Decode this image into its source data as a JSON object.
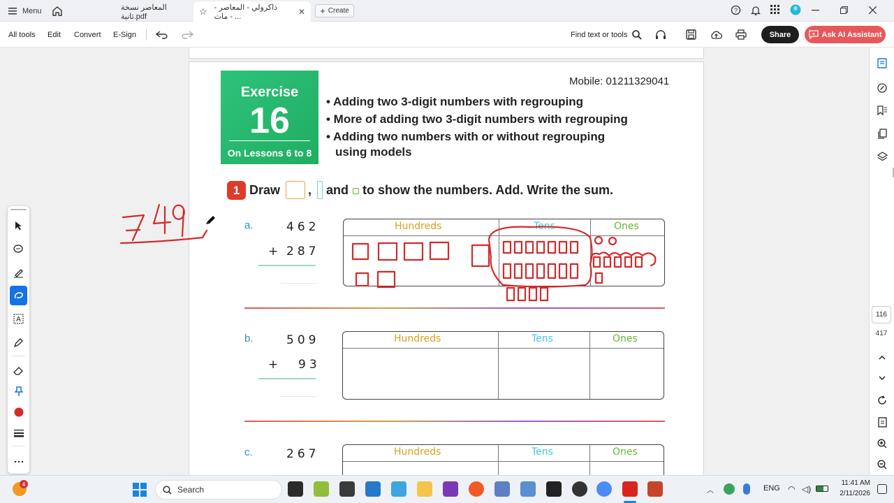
{
  "titlebar": {
    "menu_label": "Menu",
    "tabs": [
      {
        "label": "المعاصر نسخة ثانية.pdf"
      },
      {
        "label": "ذاكرولي - المعاصر - ماث - ..."
      }
    ],
    "create_label": "Create"
  },
  "toolbar": {
    "all_tools": "All tools",
    "edit": "Edit",
    "convert": "Convert",
    "esign": "E-Sign",
    "find": "Find text or tools",
    "share": "Share",
    "ask_ai": "Ask AI Assistant"
  },
  "worksheet": {
    "exercise_word": "Exercise",
    "exercise_number": "16",
    "lessons": "On Lessons 6 to 8",
    "mobile": "Mobile: 01211329041",
    "bullets": [
      "• Adding two 3-digit numbers with regrouping",
      "• More of adding two 3-digit numbers with regrouping",
      "• Adding two numbers with or without regrouping",
      "using models"
    ],
    "question_number": "1",
    "instruction_draw": "Draw",
    "instruction_comma": ",",
    "instruction_and": "and",
    "instruction_rest": "to show the numbers. Add. Write the sum.",
    "columns": [
      "Hundreds",
      "Tens",
      "Ones"
    ],
    "column_colors": {
      "hundreds": "#d9a21b",
      "tens": "#48c4d6",
      "ones": "#63b832"
    },
    "problems": [
      {
        "letter": "a.",
        "top": "462",
        "bottom": "287",
        "plus": "+"
      },
      {
        "letter": "b.",
        "top": "509",
        "bottom": "93",
        "plus": "+"
      },
      {
        "letter": "c.",
        "top": "267"
      }
    ],
    "handwritten_sum": "749"
  },
  "rail": {
    "page_current": "116",
    "page_total": "417"
  },
  "taskbar": {
    "search_placeholder": "Search",
    "badge": "4",
    "lang": "ENG",
    "time": "11:41 AM",
    "date": "2/11/2026"
  },
  "colors": {
    "accent": "#1473e6",
    "annotation": "#d42a2a",
    "exercise_green": "#22b46a"
  }
}
